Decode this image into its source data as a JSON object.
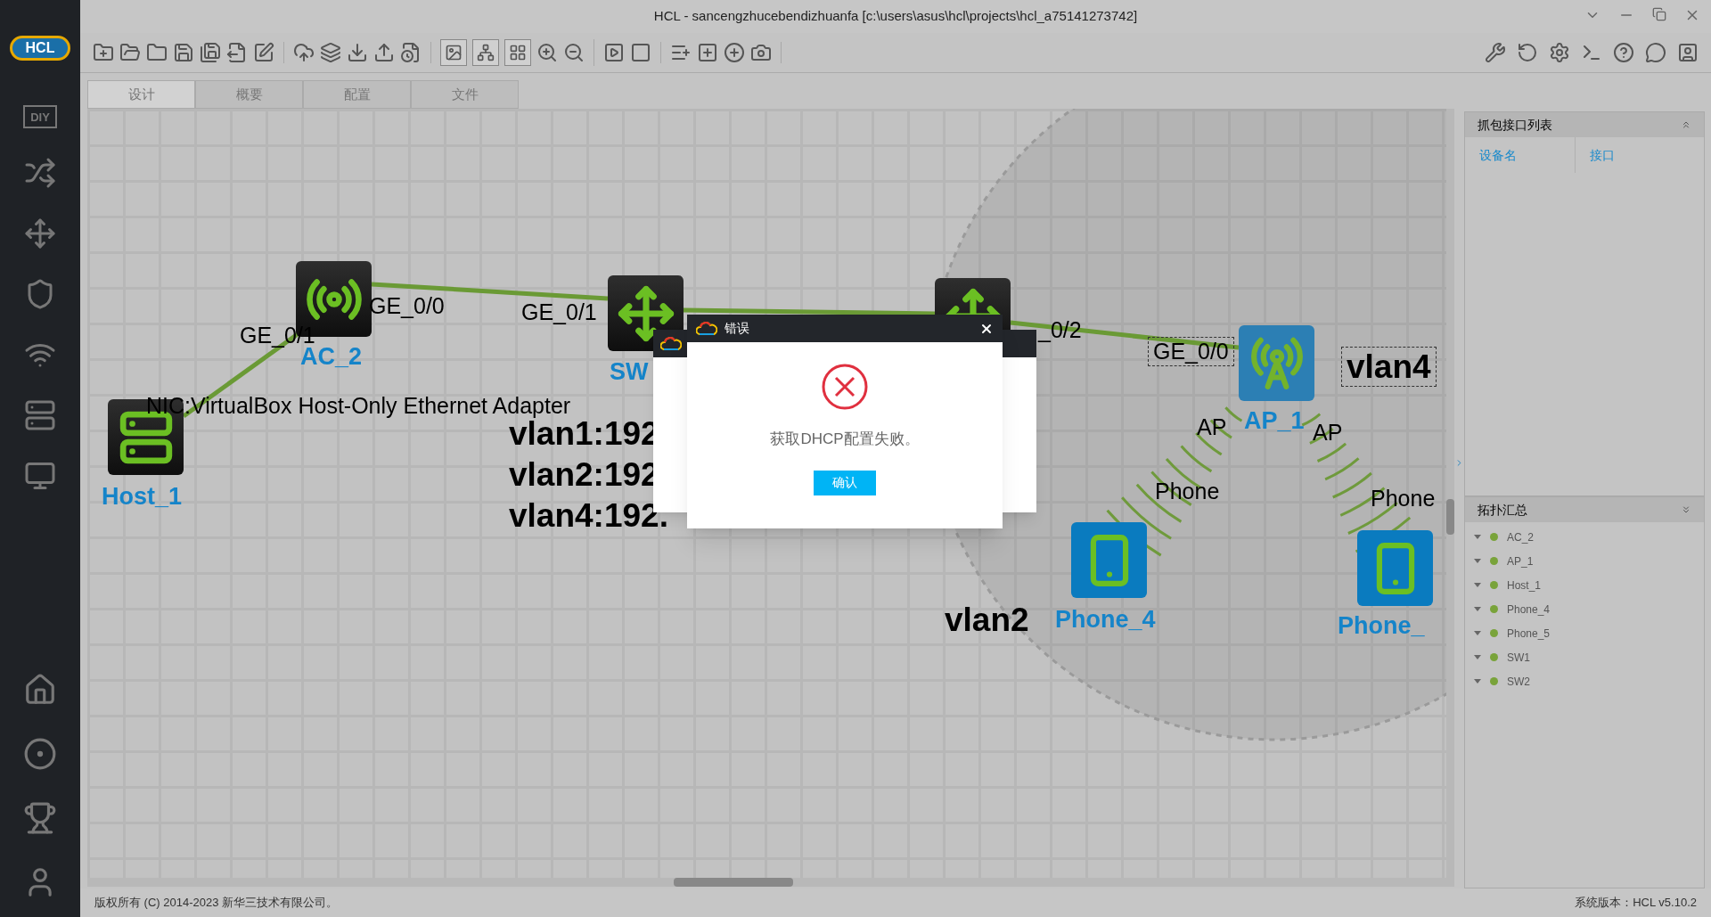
{
  "window": {
    "title": "HCL - sancengzhucebendizhuanfa [c:\\users\\asus\\hcl\\projects\\hcl_a75141273742]"
  },
  "sidebar": {
    "logo": "HCL",
    "diy_label": "DIY"
  },
  "tabs": [
    {
      "label": "设计",
      "selected": true
    },
    {
      "label": "概要",
      "selected": false
    },
    {
      "label": "配置",
      "selected": false
    },
    {
      "label": "文件",
      "selected": false
    }
  ],
  "canvas": {
    "nodes": [
      {
        "kind": "host",
        "label": "Host_1"
      },
      {
        "kind": "ac",
        "label": "AC_2"
      },
      {
        "kind": "switch",
        "label": "SW"
      },
      {
        "kind": "switch"
      },
      {
        "kind": "ap",
        "label": "AP_1"
      },
      {
        "kind": "phone",
        "label": "Phone_4"
      },
      {
        "kind": "phone",
        "label": "Phone_"
      }
    ],
    "labels": [
      {
        "kind": "port",
        "text": "GE_0/1",
        "boxed": false
      },
      {
        "kind": "port",
        "text": "GE_0/0",
        "boxed": false
      },
      {
        "kind": "port",
        "text": "GE_0/1",
        "boxed": false
      },
      {
        "kind": "port",
        "text": "_0/2",
        "boxed": false
      },
      {
        "kind": "port",
        "text": "GE_0/0",
        "boxed": true
      },
      {
        "kind": "port",
        "text": "NIC:VirtualBox Host-Only Ethernet Adapter",
        "boxed": false
      },
      {
        "kind": "note",
        "text": "vlan1:192",
        "boxed": false
      },
      {
        "kind": "note",
        "text": "vlan2:192",
        "boxed": false
      },
      {
        "kind": "note",
        "text": "vlan4:192.",
        "boxed": false
      },
      {
        "kind": "note",
        "text": "vlan4",
        "boxed": true
      },
      {
        "kind": "port",
        "text": "AP",
        "boxed": false
      },
      {
        "kind": "port",
        "text": "AP",
        "boxed": false
      },
      {
        "kind": "port",
        "text": "Phone",
        "boxed": false
      },
      {
        "kind": "port",
        "text": "Phone",
        "boxed": false
      },
      {
        "kind": "note",
        "text": "vlan2",
        "boxed": false
      }
    ]
  },
  "dialog": {
    "title": "错误",
    "message": "获取DHCP配置失败。",
    "button": "确认"
  },
  "right_panel": {
    "capture": {
      "title": "抓包接口列表",
      "columns": [
        "设备名",
        "接口"
      ]
    },
    "topology": {
      "title": "拓扑汇总",
      "items": [
        {
          "label": "AC_2"
        },
        {
          "label": "AP_1"
        },
        {
          "label": "Host_1"
        },
        {
          "label": "Phone_4"
        },
        {
          "label": "Phone_5"
        },
        {
          "label": "SW1"
        },
        {
          "label": "SW2"
        }
      ]
    }
  },
  "status_bar": {
    "copyright": "版权所有 (C) 2014-2023 新华三技术有限公司。",
    "version": "系统版本：HCL v5.10.2"
  }
}
